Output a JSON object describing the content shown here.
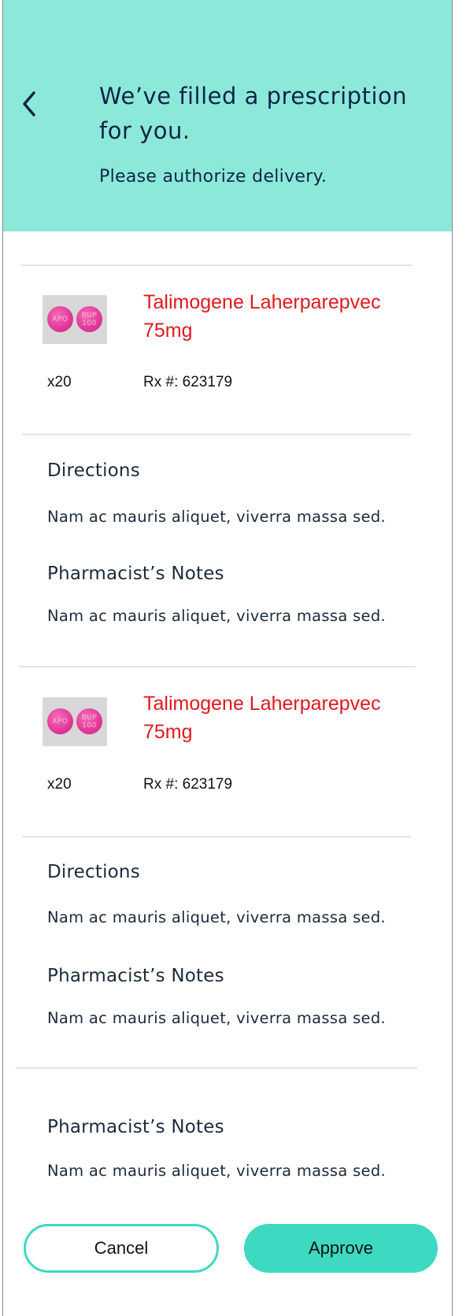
{
  "header": {
    "back_icon": "chevron-left-icon",
    "title": "We’ve filled a prescription for you.",
    "subtitle": "Please authorize delivery.",
    "background_color": "#8ce9d9"
  },
  "prescriptions": [
    {
      "drug_name": "Talimogene Laherparepvec 75mg",
      "quantity": "x20",
      "rx_number": "Rx #: 623179",
      "pill_imprints": [
        "APO",
        "BUP 100"
      ],
      "directions_heading": "Directions",
      "directions_text": "Nam ac mauris aliquet, viverra massa sed.",
      "notes_heading": "Pharmacist’s Notes",
      "notes_text": "Nam ac mauris aliquet, viverra massa sed."
    },
    {
      "drug_name": "Talimogene Laherparepvec 75mg",
      "quantity": "x20",
      "rx_number": "Rx #: 623179",
      "pill_imprints": [
        "APO",
        "BUP 100"
      ],
      "directions_heading": "Directions",
      "directions_text": "Nam ac mauris aliquet, viverra massa sed.",
      "notes_heading": "Pharmacist’s Notes",
      "notes_text": "Nam ac mauris aliquet, viverra massa sed."
    }
  ],
  "extra_notes": {
    "heading": "Pharmacist’s Notes",
    "text": "Nam ac mauris aliquet, viverra massa sed."
  },
  "actions": {
    "cancel_label": "Cancel",
    "approve_label": "Approve",
    "accent_color": "#3dd9c1"
  },
  "colors": {
    "drug_name": "#e0191f",
    "text_dark": "#0f2547"
  }
}
